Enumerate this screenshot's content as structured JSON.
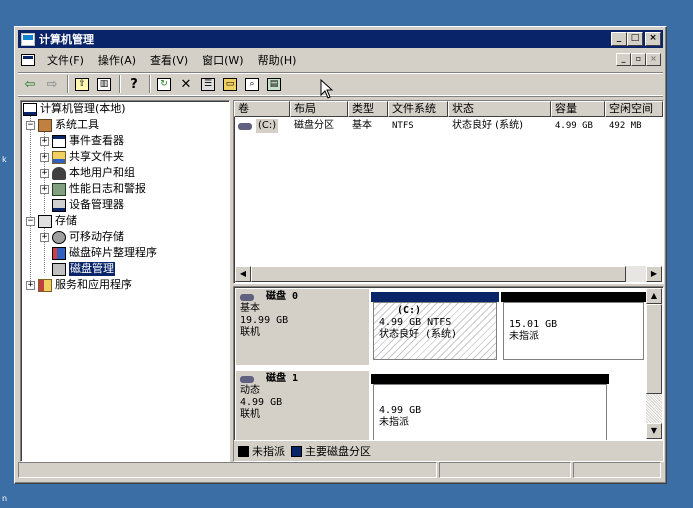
{
  "window": {
    "title": "计算机管理"
  },
  "menu": [
    "文件(F)",
    "操作(A)",
    "查看(V)",
    "窗口(W)",
    "帮助(H)"
  ],
  "toolbar_icons": [
    "back-icon",
    "forward-icon",
    "up-icon",
    "show-hide-tree-icon",
    "help-icon",
    "refresh-icon",
    "delete-icon",
    "properties-icon",
    "open-icon",
    "search-icon",
    "export-icon"
  ],
  "tree": [
    {
      "label": "计算机管理(本地)",
      "icon": "computer-icon"
    },
    {
      "label": "系统工具",
      "icon": "tools-icon"
    },
    {
      "label": "事件查看器",
      "icon": "event-viewer-icon"
    },
    {
      "label": "共享文件夹",
      "icon": "shared-folder-icon"
    },
    {
      "label": "本地用户和组",
      "icon": "users-icon"
    },
    {
      "label": "性能日志和警报",
      "icon": "performance-icon"
    },
    {
      "label": "设备管理器",
      "icon": "device-manager-icon"
    },
    {
      "label": "存储",
      "icon": "storage-icon"
    },
    {
      "label": "可移动存储",
      "icon": "removable-storage-icon"
    },
    {
      "label": "磁盘碎片整理程序",
      "icon": "defrag-icon"
    },
    {
      "label": "磁盘管理",
      "icon": "disk-management-icon"
    },
    {
      "label": "服务和应用程序",
      "icon": "services-icon"
    }
  ],
  "volume_list": {
    "columns": [
      "卷",
      "布局",
      "类型",
      "文件系统",
      "状态",
      "容量",
      "空闲空间"
    ],
    "rows": [
      {
        "volume": "(C:)",
        "layout": "磁盘分区",
        "type": "基本",
        "fs": "NTFS",
        "status": "状态良好 (系统)",
        "capacity": "4.99 GB",
        "free": "492 MB"
      }
    ]
  },
  "disks": [
    {
      "name": "磁盘 0",
      "type": "基本",
      "size": "19.99 GB",
      "state": "联机",
      "partitions": [
        {
          "title": "(C:)",
          "line1": "4.99 GB NTFS",
          "line2": "状态良好 (系统)"
        },
        {
          "title": "",
          "line1": "15.01 GB",
          "line2": "未指派"
        }
      ]
    },
    {
      "name": "磁盘 1",
      "type": "动态",
      "size": "4.99 GB",
      "state": "联机",
      "partitions": [
        {
          "title": "",
          "line1": "4.99 GB",
          "line2": "未指派"
        }
      ]
    }
  ],
  "legend": [
    {
      "label": "未指派",
      "color": "#000000"
    },
    {
      "label": "主要磁盘分区",
      "color": "#0a246a"
    }
  ],
  "colors": {
    "title_bar": "#0a246a",
    "desktop": "#3a6ea5",
    "unallocated": "#000000",
    "primary_partition": "#0a246a"
  }
}
